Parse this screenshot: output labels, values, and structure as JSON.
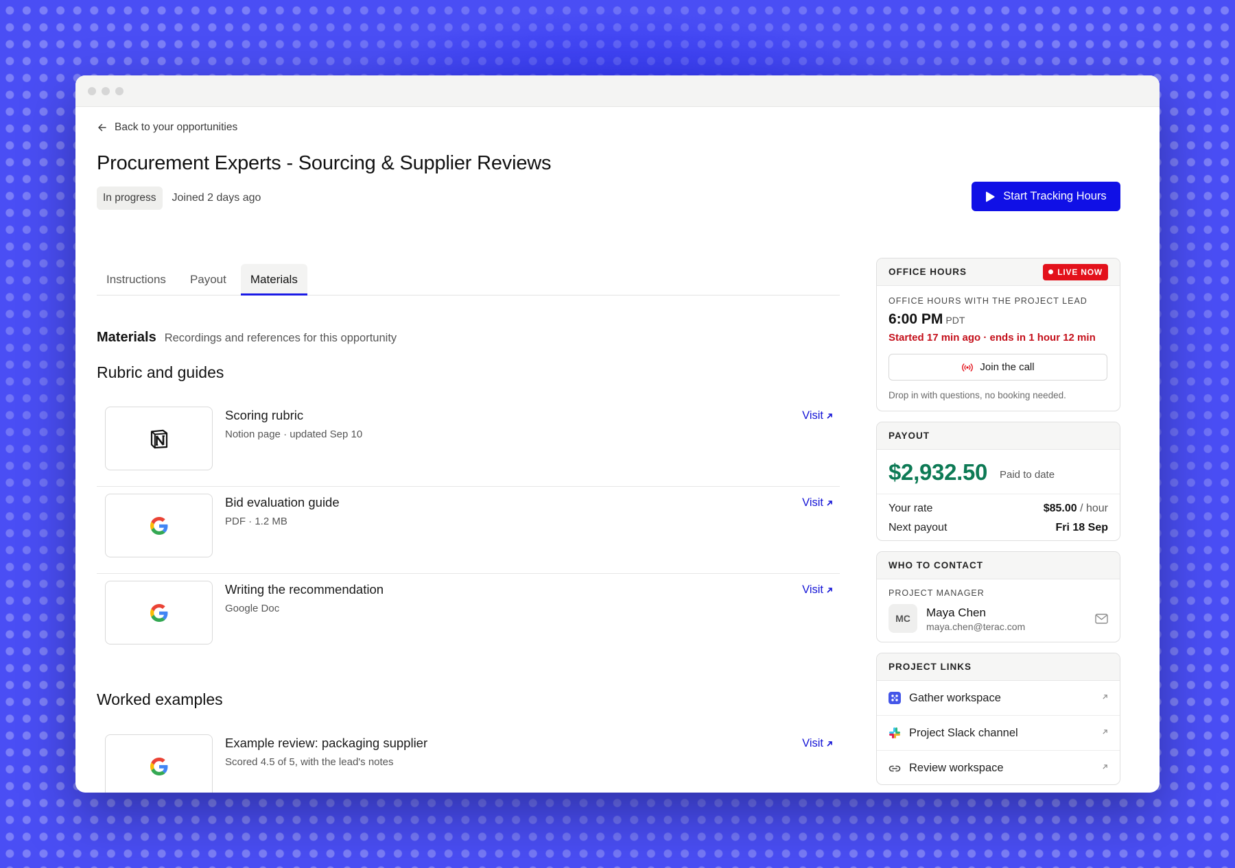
{
  "nav": {
    "back_label": "Back to your opportunities"
  },
  "header": {
    "title": "Procurement Experts - Sourcing & Supplier Reviews",
    "status_badge": "In progress",
    "joined": "Joined 2 days ago",
    "start_button": "Start Tracking Hours"
  },
  "tabs": [
    {
      "label": "Instructions",
      "active": false
    },
    {
      "label": "Payout",
      "active": false
    },
    {
      "label": "Materials",
      "active": true
    }
  ],
  "materials": {
    "title": "Materials",
    "subtitle": "Recordings and references for this opportunity",
    "sections": [
      {
        "title": "Rubric and guides",
        "items": [
          {
            "name": "Scoring rubric",
            "desc": "Notion page · updated Sep 10",
            "icon": "notion-icon",
            "action": "Visit"
          },
          {
            "name": "Bid evaluation guide",
            "desc": "PDF · 1.2 MB",
            "icon": "google-icon",
            "action": "Visit"
          },
          {
            "name": "Writing the recommendation",
            "desc": "Google Doc",
            "icon": "google-icon",
            "action": "Visit"
          }
        ]
      },
      {
        "title": "Worked examples",
        "items": [
          {
            "name": "Example review: packaging supplier",
            "desc": "Scored 4.5 of 5, with the lead's notes",
            "icon": "google-icon",
            "action": "Visit"
          }
        ]
      }
    ]
  },
  "office_hours": {
    "heading": "OFFICE HOURS",
    "live_badge": "LIVE NOW",
    "subheading": "OFFICE HOURS WITH THE PROJECT LEAD",
    "time": "6:00 PM",
    "timezone": "PDT",
    "status": "Started 17 min ago · ends in 1 hour 12 min",
    "join_button": "Join the call",
    "note": "Drop in with questions, no booking needed."
  },
  "payout": {
    "heading": "PAYOUT",
    "amount": "$2,932.50",
    "amount_label": "Paid to date",
    "rate_label": "Your rate",
    "rate_value": "$85.00",
    "rate_unit": "/ hour",
    "next_label": "Next payout",
    "next_value": "Fri 18 Sep"
  },
  "contact": {
    "heading": "WHO TO CONTACT",
    "role": "PROJECT MANAGER",
    "initials": "MC",
    "name": "Maya Chen",
    "email": "maya.chen@terac.com"
  },
  "project_links": {
    "heading": "PROJECT LINKS",
    "items": [
      {
        "label": "Gather workspace",
        "icon": "gather-icon"
      },
      {
        "label": "Project Slack channel",
        "icon": "slack-icon"
      },
      {
        "label": "Review workspace",
        "icon": "link-icon"
      }
    ]
  },
  "colors": {
    "background_blue": "#1d22f2",
    "primary_button": "#1010e6",
    "live_red": "#e3111b",
    "payout_green": "#0d7a55",
    "link_blue": "#1414d6"
  }
}
